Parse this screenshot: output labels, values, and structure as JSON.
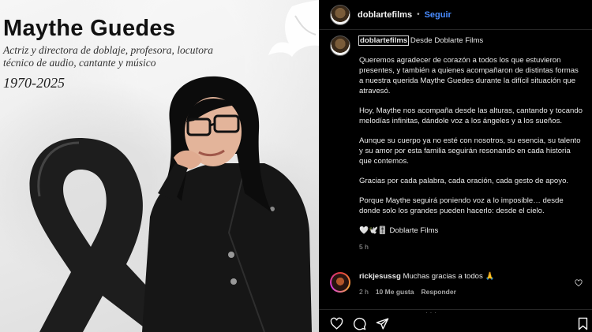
{
  "image": {
    "name": "Maythe Guedes",
    "subtitle_line1": "Actriz y directora de doblaje, profesora, locutora",
    "subtitle_line2": "técnico de audio, cantante y músico",
    "years": "1970-2025"
  },
  "header": {
    "username": "doblartefilms",
    "separator": "•",
    "follow_label": "Seguir"
  },
  "caption": {
    "username": "doblartefilms",
    "lead": " Desde Doblarte Films",
    "paragraphs": [
      "Queremos agradecer de corazón a todos los que estuvieron presentes, y también a quienes acompañaron de distintas formas a nuestra querida Maythe Guedes durante la difícil situación que atravesó.",
      "Hoy, Maythe nos acompaña desde las alturas, cantando y tocando melodías infinitas, dándole voz a los ángeles y a los sueños.",
      "Aunque su cuerpo ya no esté con nosotros, su esencia, su talento y su amor por esta familia seguirán resonando en cada historia que contemos.",
      "Gracias por cada palabra, cada oración, cada gesto de apoyo.",
      "Porque Maythe seguirá poniendo voz a lo imposible… desde donde solo los grandes pueden hacerlo: desde el cielo."
    ],
    "signoff": "🤍🕊️🎚️ Doblarte Films",
    "time": "5 h"
  },
  "comment": {
    "username": "rickjesussg",
    "text": " Muchas gracias a todos 🙏",
    "time": "2 h",
    "likes": "10 Me gusta",
    "reply_label": "Responder"
  },
  "icons": {
    "like": "heart-icon",
    "comment": "comment-icon",
    "share": "share-icon",
    "save": "bookmark-icon"
  },
  "colors": {
    "accent": "#4a8cff",
    "background": "#000000"
  }
}
